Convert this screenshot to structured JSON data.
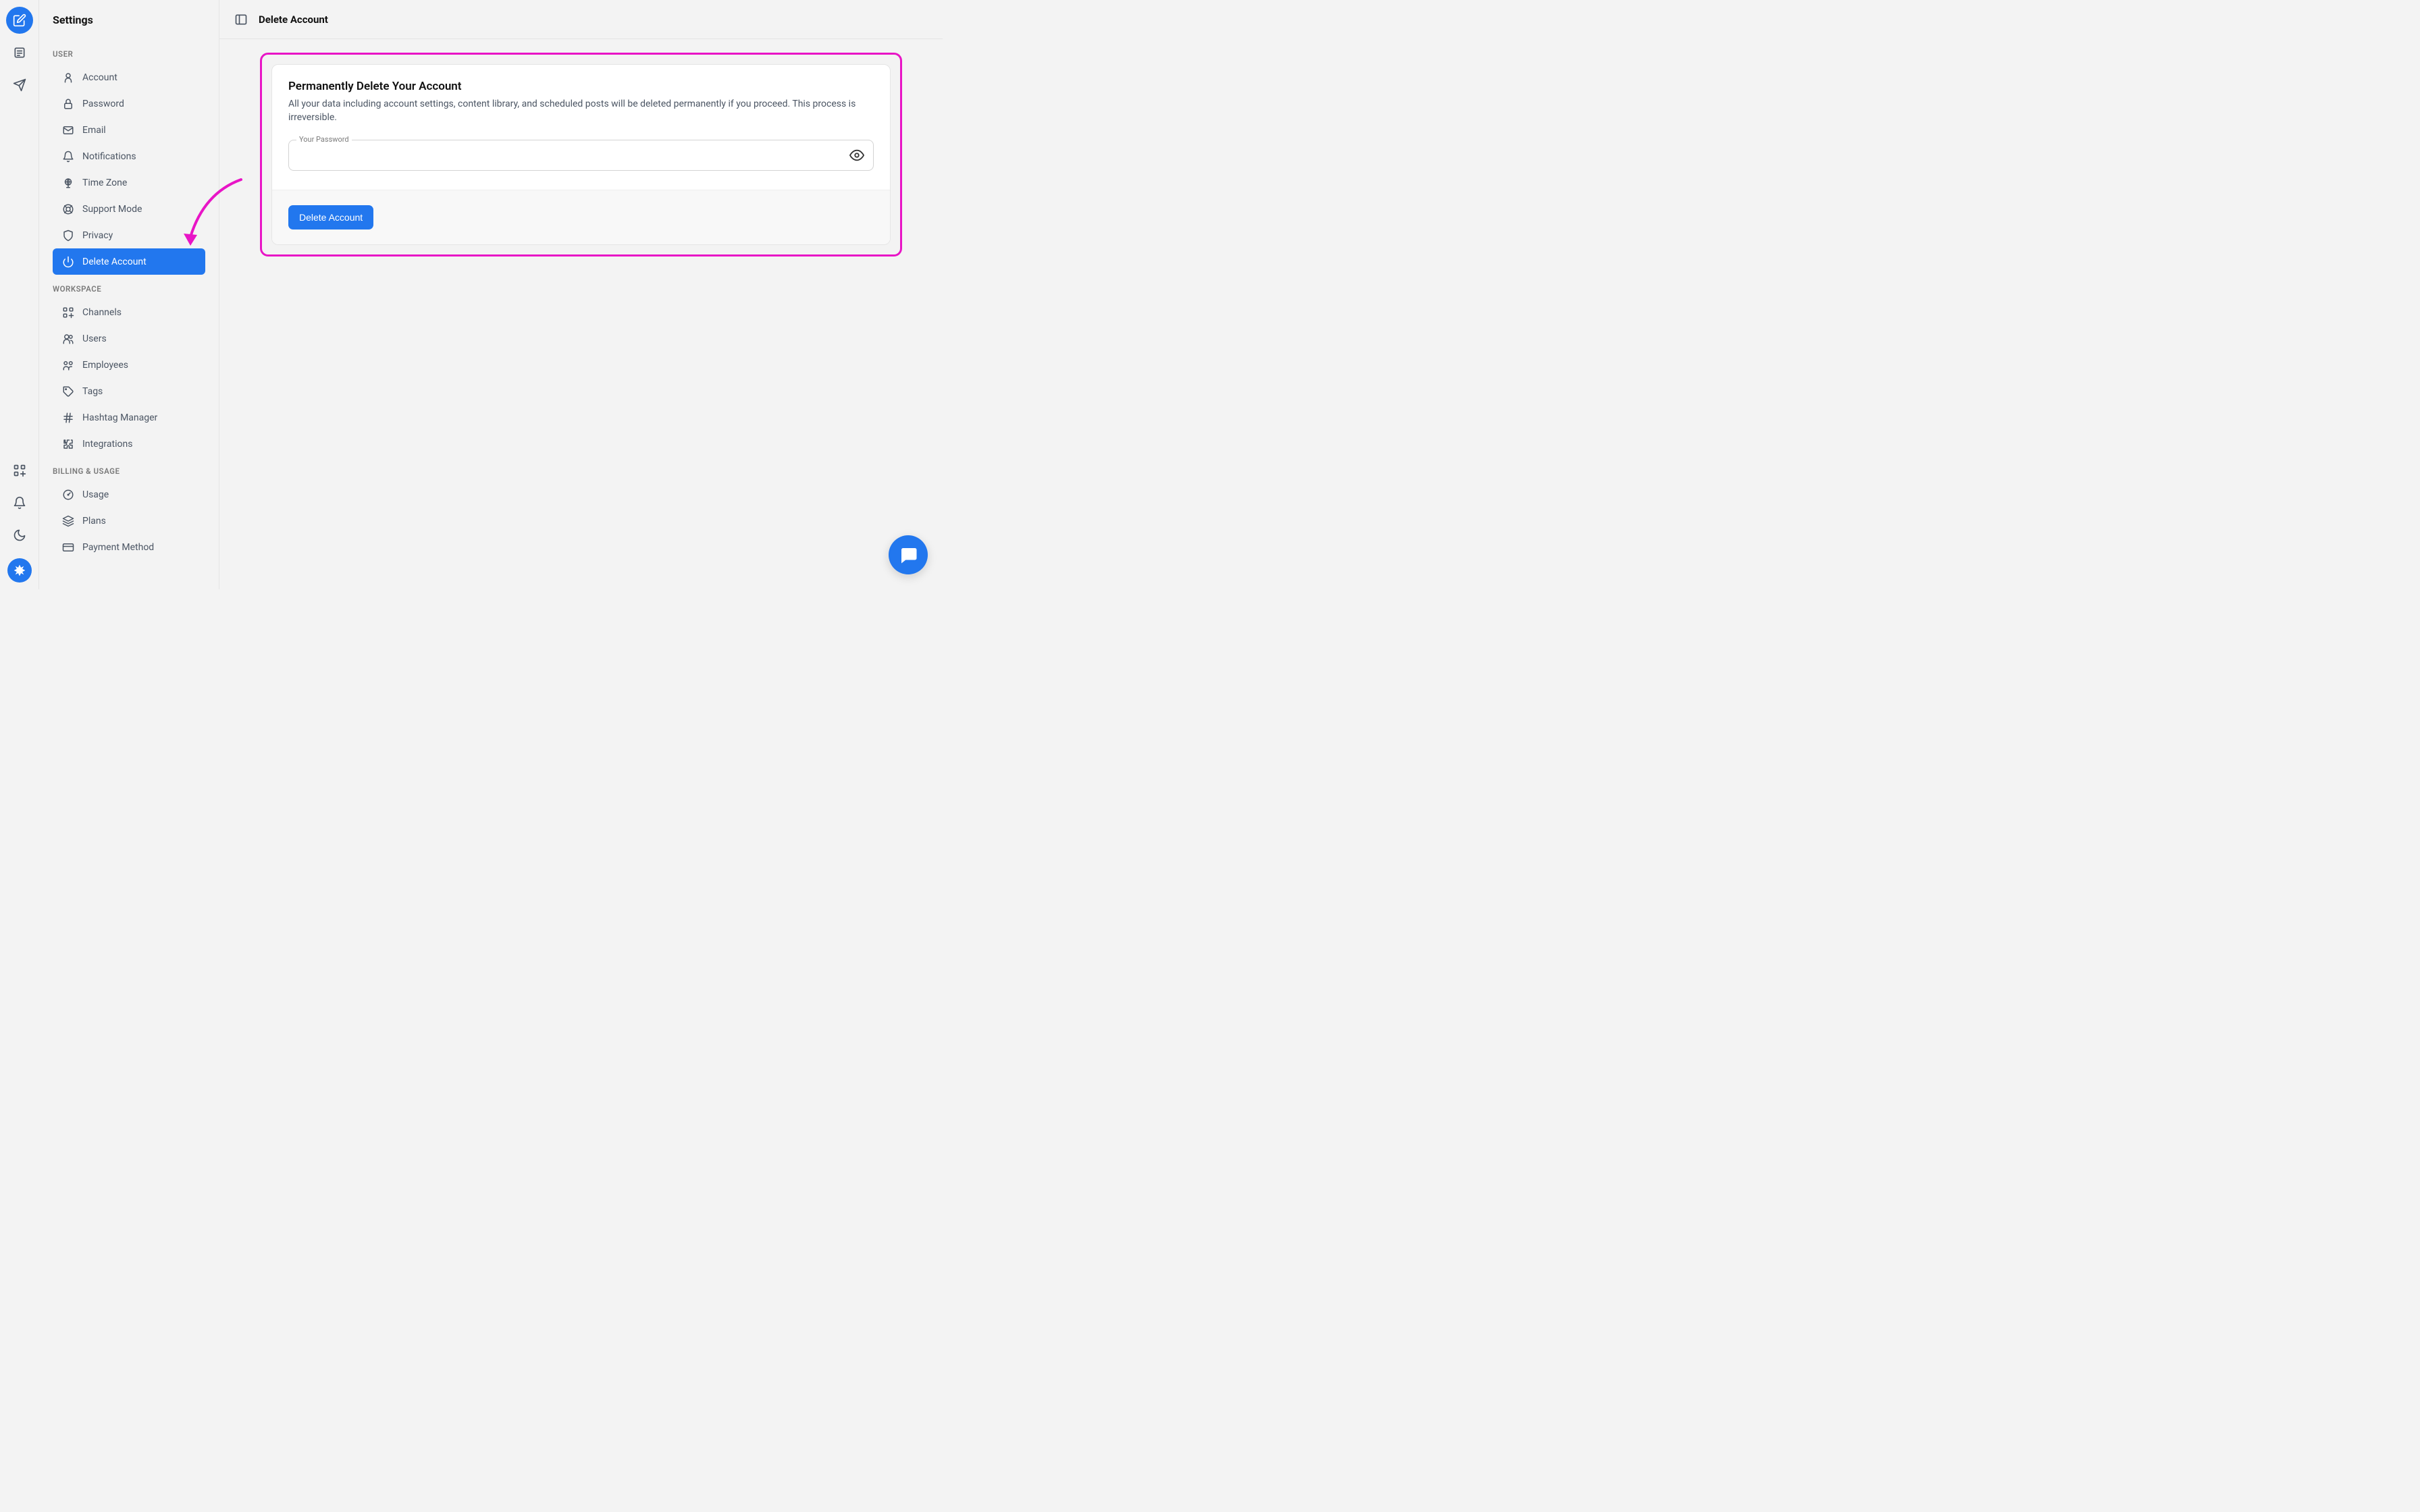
{
  "sidebar_title": "Settings",
  "sections": {
    "user_label": "USER",
    "workspace_label": "WORKSPACE",
    "billing_label": "BILLING & USAGE"
  },
  "nav": {
    "account": "Account",
    "password": "Password",
    "email": "Email",
    "notifications": "Notifications",
    "time_zone": "Time Zone",
    "support_mode": "Support Mode",
    "privacy": "Privacy",
    "delete_account": "Delete Account",
    "channels": "Channels",
    "users": "Users",
    "employees": "Employees",
    "tags": "Tags",
    "hashtag_manager": "Hashtag Manager",
    "integrations": "Integrations",
    "usage": "Usage",
    "plans": "Plans",
    "payment_method": "Payment Method"
  },
  "page": {
    "title": "Delete Account",
    "card_title": "Permanently Delete Your Account",
    "card_desc": "All your data including account settings, content library, and scheduled posts will be deleted permanently if you proceed. This process is irreversible.",
    "password_label": "Your Password",
    "delete_button": "Delete Account"
  }
}
